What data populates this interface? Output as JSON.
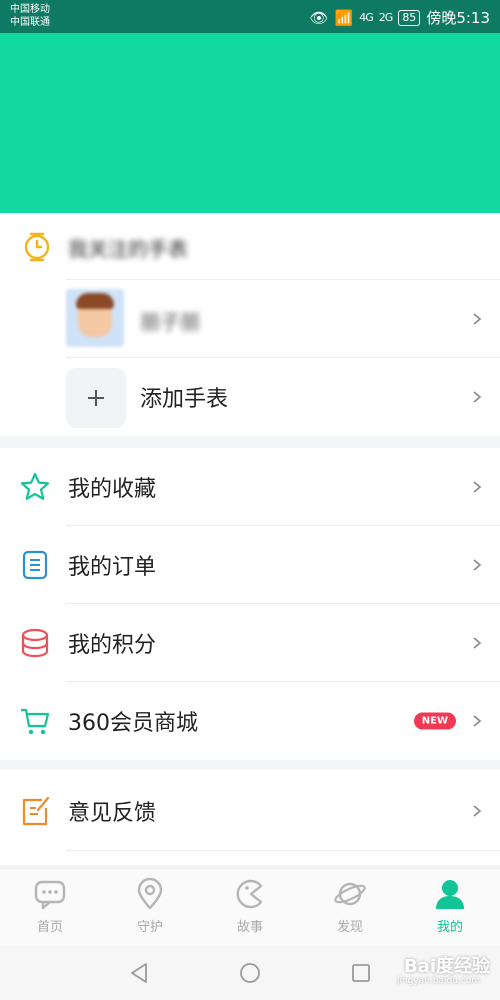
{
  "status_bar": {
    "carrier_1": "中国移动",
    "carrier_2": "中国联通",
    "signal_1": "4G",
    "signal_2": "2G",
    "battery": "85",
    "time": "傍晚5:13"
  },
  "colors": {
    "accent": "#12d9a0",
    "new_badge": "#f03a54"
  },
  "watch_section": {
    "title": "我关注的手表",
    "watch_name": "丽子丽",
    "add_watch_label": "添加手表"
  },
  "menu": {
    "favorites": "我的收藏",
    "orders": "我的订单",
    "points": "我的积分",
    "shop": "360会员商城",
    "shop_badge": "NEW",
    "feedback": "意见反馈"
  },
  "tabs": [
    {
      "label": "首页",
      "icon": "chat-icon"
    },
    {
      "label": "守护",
      "icon": "location-icon"
    },
    {
      "label": "故事",
      "icon": "pacman-icon"
    },
    {
      "label": "发现",
      "icon": "planet-icon"
    },
    {
      "label": "我的",
      "icon": "person-icon"
    }
  ],
  "watermark": {
    "brand": "Bai度经验",
    "url": "jingyan.baidu.com"
  }
}
